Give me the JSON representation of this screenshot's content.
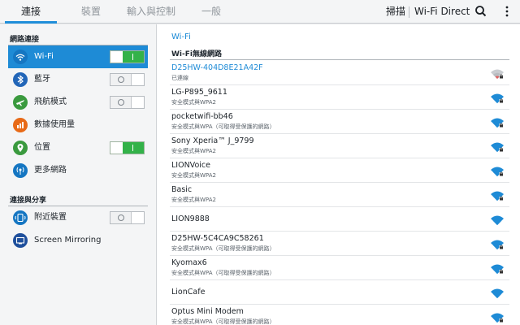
{
  "topbar": {
    "tabs": [
      "連接",
      "裝置",
      "輸入與控制",
      "一般"
    ],
    "scan_label": "掃描",
    "wifi_direct_label": "Wi-Fi Direct",
    "accent_color": "#1f8ed9"
  },
  "sidebar": {
    "section1_header": "網路連接",
    "section2_header": "連接與分享",
    "items": [
      {
        "label": "Wi-Fi",
        "icon": "wifi-icon",
        "toggle": "on",
        "selected": true
      },
      {
        "label": "藍牙",
        "icon": "bluetooth-icon",
        "toggle": "off"
      },
      {
        "label": "飛航模式",
        "icon": "airplane-icon",
        "toggle": "off"
      },
      {
        "label": "數據使用量",
        "icon": "data-usage-icon"
      },
      {
        "label": "位置",
        "icon": "location-icon",
        "toggle": "on"
      },
      {
        "label": "更多網路",
        "icon": "more-networks-icon"
      },
      {
        "label": "附近裝置",
        "icon": "nearby-devices-icon",
        "toggle": "off"
      },
      {
        "label": "Screen Mirroring",
        "icon": "screen-mirroring-icon"
      }
    ]
  },
  "main": {
    "title": "Wi-Fi",
    "list_header": "Wi-Fi無線網路",
    "networks": [
      {
        "name": "D25HW-404D8E21A42F",
        "status": "已連線",
        "connected": true
      },
      {
        "name": "LG-P895_9611",
        "status": "安全模式與WPA2"
      },
      {
        "name": "pocketwifi-bb46",
        "status": "安全模式與WPA（可取得受保護的網路）"
      },
      {
        "name": "Sony Xperia™ J_9799",
        "status": "安全模式與WPA2"
      },
      {
        "name": "LIONVoice",
        "status": "安全模式與WPA2"
      },
      {
        "name": "Basic",
        "status": "安全模式與WPA2"
      },
      {
        "name": "LION9888",
        "status": ""
      },
      {
        "name": "D25HW-5C4CA9C58261",
        "status": "安全模式與WPA（可取得受保護的網路）"
      },
      {
        "name": "Kyomax6",
        "status": "安全模式與WPA（可取得受保護的網路）"
      },
      {
        "name": "LionCafe",
        "status": ""
      },
      {
        "name": "Optus Mini Modem",
        "status": "安全模式與WPA（可取得受保護的網路）"
      }
    ]
  }
}
